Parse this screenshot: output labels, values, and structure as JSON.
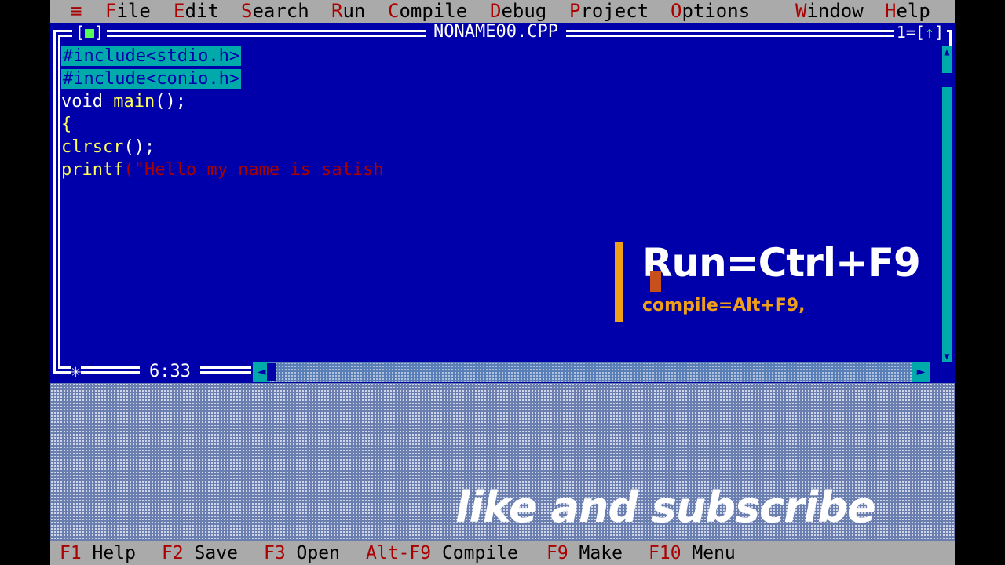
{
  "menu": {
    "system": "≡",
    "items": [
      {
        "hk": "F",
        "rest": "ile"
      },
      {
        "hk": "E",
        "rest": "dit"
      },
      {
        "hk": "S",
        "rest": "earch"
      },
      {
        "hk": "R",
        "rest": "un"
      },
      {
        "hk": "C",
        "rest": "ompile"
      },
      {
        "hk": "D",
        "rest": "ebug"
      },
      {
        "hk": "P",
        "rest": "roject"
      },
      {
        "hk": "O",
        "rest": "ptions"
      },
      {
        "hk": "W",
        "rest": "indow"
      },
      {
        "hk": "H",
        "rest": "elp"
      }
    ]
  },
  "editor": {
    "title": "NONAME00.CPP",
    "close_left": "[",
    "close_mark": "■",
    "close_right": "]",
    "window_number": "1=[",
    "zoom_icon": "↑",
    "window_number_end": "]",
    "position": "6:33",
    "code": {
      "line1": "#include<stdio.h>",
      "line2": "#include<conio.h>",
      "line3_kw": "void ",
      "line3_ident": "main",
      "line3_rest": "();",
      "line4": "{",
      "line5_ident": "clrscr",
      "line5_rest": "();",
      "line6_ident": "printf",
      "line6_paren": "(",
      "line6_str": "\"Hello my name is satish"
    }
  },
  "overlay": {
    "run_hint": "Run=Ctrl+F9",
    "compile_hint": "compile=Alt+F9,",
    "subscribe": "like and subscribe"
  },
  "fkeys": [
    {
      "key": "F1",
      "label": " Help"
    },
    {
      "key": "F2",
      "label": " Save"
    },
    {
      "key": "F3",
      "label": " Open"
    },
    {
      "key": "Alt-F9",
      "label": " Compile"
    },
    {
      "key": "F9",
      "label": " Make"
    },
    {
      "key": "F10",
      "label": " Menu"
    }
  ],
  "colors": {
    "background": "#0000aa",
    "menu_bar": "#aaaaaa",
    "hotkey": "#aa0000",
    "include_highlight": "#00aaaa",
    "accent": "#f0a018"
  }
}
